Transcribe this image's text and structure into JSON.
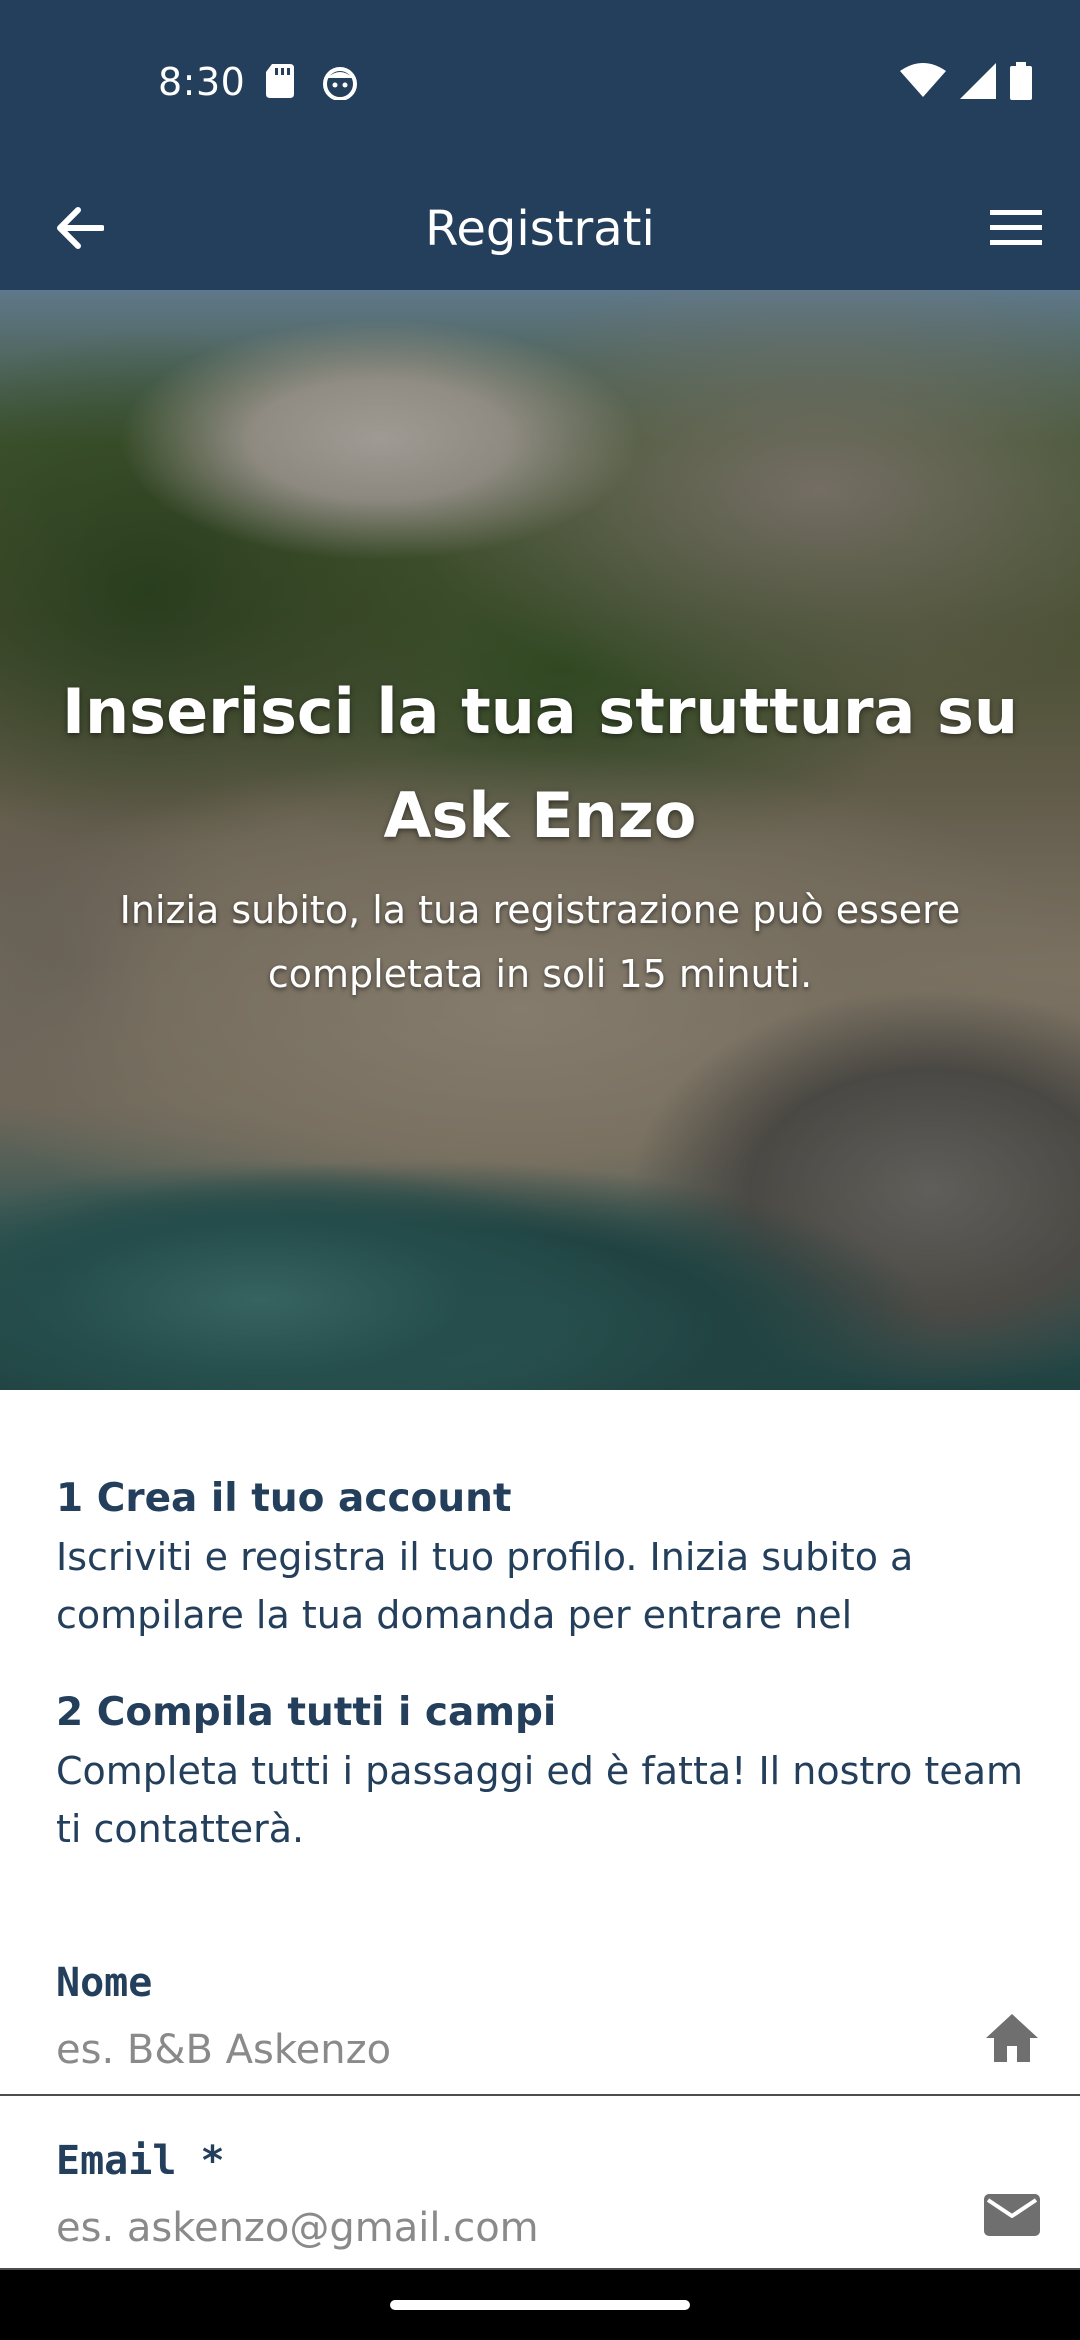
{
  "status_bar": {
    "time": "8:30",
    "left_icons": [
      "sd-card-icon",
      "notification-face-icon"
    ],
    "right_icons": [
      "wifi-icon",
      "cellular-signal-icon",
      "battery-icon"
    ]
  },
  "app_bar": {
    "title": "Registrati",
    "back_icon": "arrow-left-icon",
    "menu_icon": "hamburger-menu-icon",
    "background": "#243f5b"
  },
  "hero": {
    "title": "Inserisci la tua struttura su Ask Enzo",
    "subtitle": "Inizia subito, la tua registrazione può essere completata in soli 15 minuti."
  },
  "steps": [
    {
      "title": "1 Crea il tuo account",
      "text": "Iscriviti e registra il tuo profilo. Inizia subito a compilare la tua domanda per entrare nel"
    },
    {
      "title": "2 Compila tutti i campi",
      "text": "Completa tutti i passaggi ed è fatta! Il nostro team ti contatterà."
    }
  ],
  "form": {
    "name": {
      "label": "Nome",
      "placeholder": "es. B&B Askenzo",
      "value": "",
      "icon": "home-icon"
    },
    "email": {
      "label": "Email *",
      "placeholder": "es. askenzo@gmail.com",
      "value": "",
      "icon": "mail-icon"
    }
  },
  "colors": {
    "primary": "#243f5b",
    "text_dark": "#243f5b",
    "placeholder": "#8a8a8a",
    "icon_gray": "#6f6f6f"
  }
}
